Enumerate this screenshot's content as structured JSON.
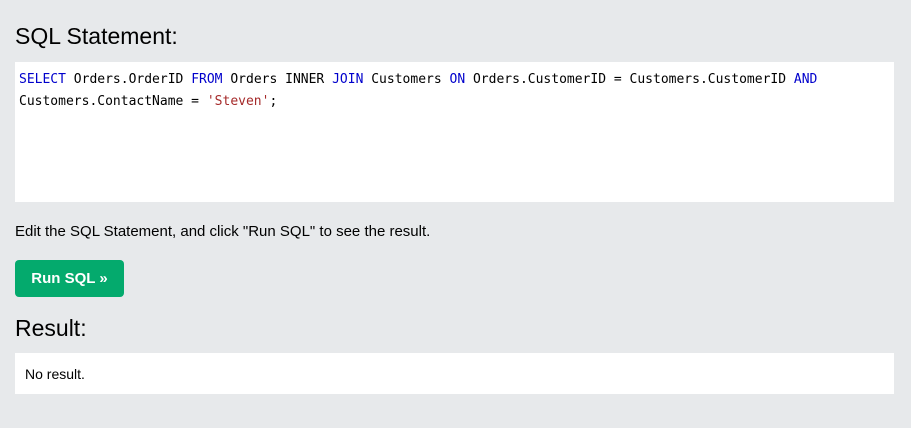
{
  "sql_section": {
    "title": "SQL Statement:",
    "query": {
      "line1": {
        "t1": "SELECT",
        "t2": " Orders.OrderID ",
        "t3": "FROM",
        "t4": " Orders INNER ",
        "t5": "JOIN",
        "t6": " Customers ",
        "t7": "ON",
        "t8": " Orders.CustomerID = Customers.CustomerID ",
        "t9": "AND"
      },
      "line2": {
        "t1": "Customers.ContactName = ",
        "t2": "'Steven'",
        "t3": ";"
      }
    }
  },
  "instruction": "Edit the SQL Statement, and click \"Run SQL\" to see the result.",
  "run_button": {
    "label": "Run SQL »"
  },
  "result_section": {
    "title": "Result:",
    "message": "No result."
  },
  "colors": {
    "background": "#e7e9eb",
    "button": "#04aa6d",
    "keyword": "#0000cc",
    "string": "#a52a2a"
  }
}
